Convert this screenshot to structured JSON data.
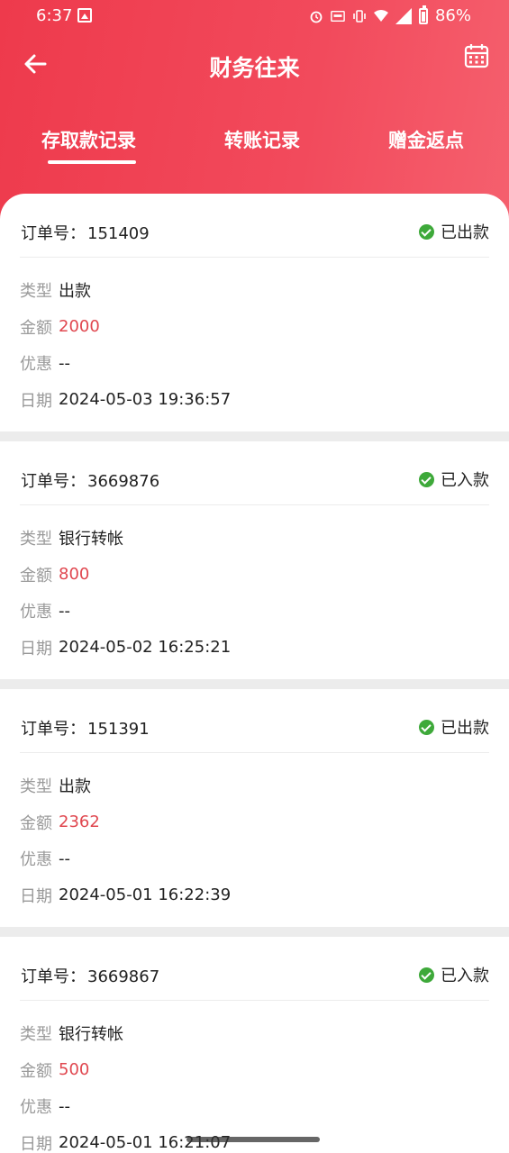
{
  "status_bar": {
    "time": "6:37",
    "battery": "86%"
  },
  "header": {
    "title": "财务往来"
  },
  "tabs": [
    {
      "label": "存取款记录",
      "active": true
    },
    {
      "label": "转账记录",
      "active": false
    },
    {
      "label": "赠金返点",
      "active": false
    }
  ],
  "labels": {
    "order_no": "订单号：",
    "type": "类型",
    "amount": "金额",
    "discount": "优惠",
    "date": "日期"
  },
  "records": [
    {
      "order_no": "151409",
      "status": "已出款",
      "type": "出款",
      "amount": "2000",
      "discount": "--",
      "date": "2024-05-03 19:36:57"
    },
    {
      "order_no": "3669876",
      "status": "已入款",
      "type": "银行转帐",
      "amount": "800",
      "discount": "--",
      "date": "2024-05-02 16:25:21"
    },
    {
      "order_no": "151391",
      "status": "已出款",
      "type": "出款",
      "amount": "2362",
      "discount": "--",
      "date": "2024-05-01 16:22:39"
    },
    {
      "order_no": "3669867",
      "status": "已入款",
      "type": "银行转帐",
      "amount": "500",
      "discount": "--",
      "date": "2024-05-01 16:21:07"
    }
  ],
  "colors": {
    "brand": "#ee3a4c",
    "amount": "#e0474f",
    "success": "#3ea93a"
  }
}
